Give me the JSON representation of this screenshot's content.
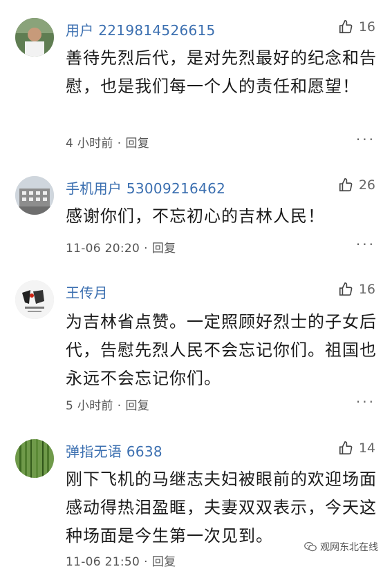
{
  "comments": [
    {
      "username": "用户 2219814526615",
      "likes": "16",
      "body": "善待先烈后代，是对先烈最好的纪念和告慰，也是我们每一个人的责任和愿望！",
      "time": "4 小时前",
      "sep": "·",
      "reply": "回复",
      "more": "···"
    },
    {
      "username": "手机用户 53009216462",
      "likes": "26",
      "body": "感谢你们，不忘初心的吉林人民！",
      "time": "11-06 20:20",
      "sep": "·",
      "reply": "回复",
      "more": "···"
    },
    {
      "username": "王传月",
      "likes": "16",
      "body": "为吉林省点赞。一定照顾好烈士的子女后代，告慰先烈人民不会忘记你们。祖国也永远不会忘记你们。",
      "time": "5 小时前",
      "sep": "·",
      "reply": "回复",
      "more": "···"
    },
    {
      "username": "弹指无语 6638",
      "likes": "14",
      "body": "刚下飞机的马继志夫妇被眼前的欢迎场面感动得热泪盈眶，夫妻双双表示，今天这种场面是今生第一次见到。",
      "time": "11-06 21:50",
      "sep": "·",
      "reply": "回复",
      "more": "···"
    }
  ],
  "watermark": {
    "text": "观网东北在线"
  },
  "colors": {
    "username": "#3b6fb0",
    "text": "#1a1a1a",
    "meta": "#555555"
  }
}
